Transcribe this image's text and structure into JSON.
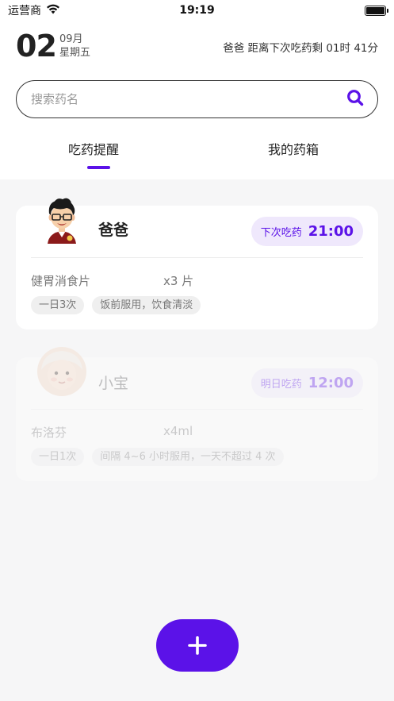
{
  "status_bar": {
    "carrier": "运营商",
    "time": "19:19"
  },
  "header": {
    "day": "02",
    "month": "09月",
    "weekday": "星期五",
    "countdown": "爸爸 距离下次吃药剩 01时 41分"
  },
  "search": {
    "placeholder": "搜索药名",
    "value": ""
  },
  "tabs": [
    {
      "label": "吃药提醒",
      "active": true
    },
    {
      "label": "我的药箱",
      "active": false
    }
  ],
  "reminders": [
    {
      "name": "爸爸",
      "next_label": "下次吃药",
      "next_time": "21:00",
      "medicine": "健胃消食片",
      "dose": "x3 片",
      "tags": [
        "一日3次",
        "饭前服用，饮食清淡"
      ]
    },
    {
      "name": "小宝",
      "next_label": "明日吃药",
      "next_time": "12:00",
      "medicine": "布洛芬",
      "dose": "x4ml",
      "tags": [
        "一日1次",
        "间隔 4~6 小时服用，一天不超过 4 次"
      ]
    }
  ],
  "colors": {
    "accent": "#5b12e8",
    "accent_light": "#efe8fc",
    "list_background": "#f6f6f7"
  },
  "icons": {
    "search": "search-icon",
    "add": "plus-icon",
    "wifi": "wifi-icon",
    "battery": "battery-icon"
  }
}
